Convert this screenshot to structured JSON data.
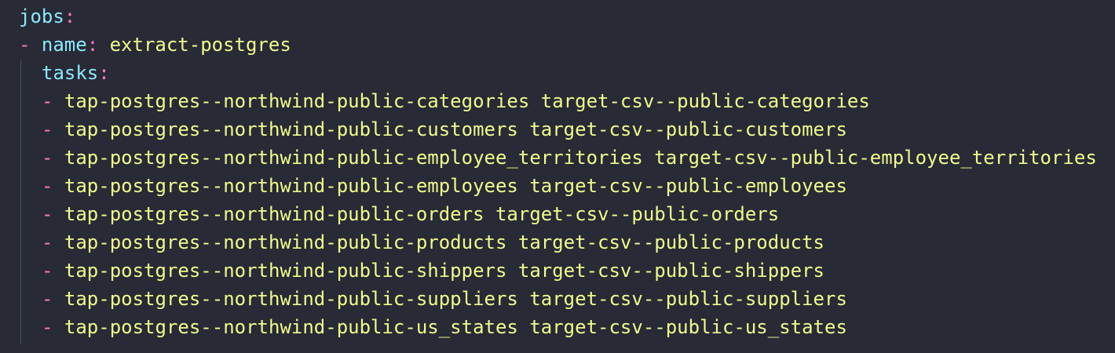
{
  "editor": {
    "lines": {
      "jobs_key": "jobs",
      "colon": ":",
      "dash": "-",
      "name_key": "name",
      "name_value": "extract-postgres",
      "tasks_key": "tasks"
    },
    "tasks": [
      "tap-postgres--northwind-public-categories target-csv--public-categories",
      "tap-postgres--northwind-public-customers target-csv--public-customers",
      "tap-postgres--northwind-public-employee_territories target-csv--public-employee_territories",
      "tap-postgres--northwind-public-employees target-csv--public-employees",
      "tap-postgres--northwind-public-orders target-csv--public-orders",
      "tap-postgres--northwind-public-products target-csv--public-products",
      "tap-postgres--northwind-public-shippers target-csv--public-shippers",
      "tap-postgres--northwind-public-suppliers target-csv--public-suppliers",
      "tap-postgres--northwind-public-us_states target-csv--public-us_states"
    ]
  },
  "colors": {
    "background": "#282a36",
    "key": "#8be9fd",
    "punctuation": "#ff79c6",
    "string": "#f1fa8c",
    "indent_guide": "#4a4d5c"
  }
}
